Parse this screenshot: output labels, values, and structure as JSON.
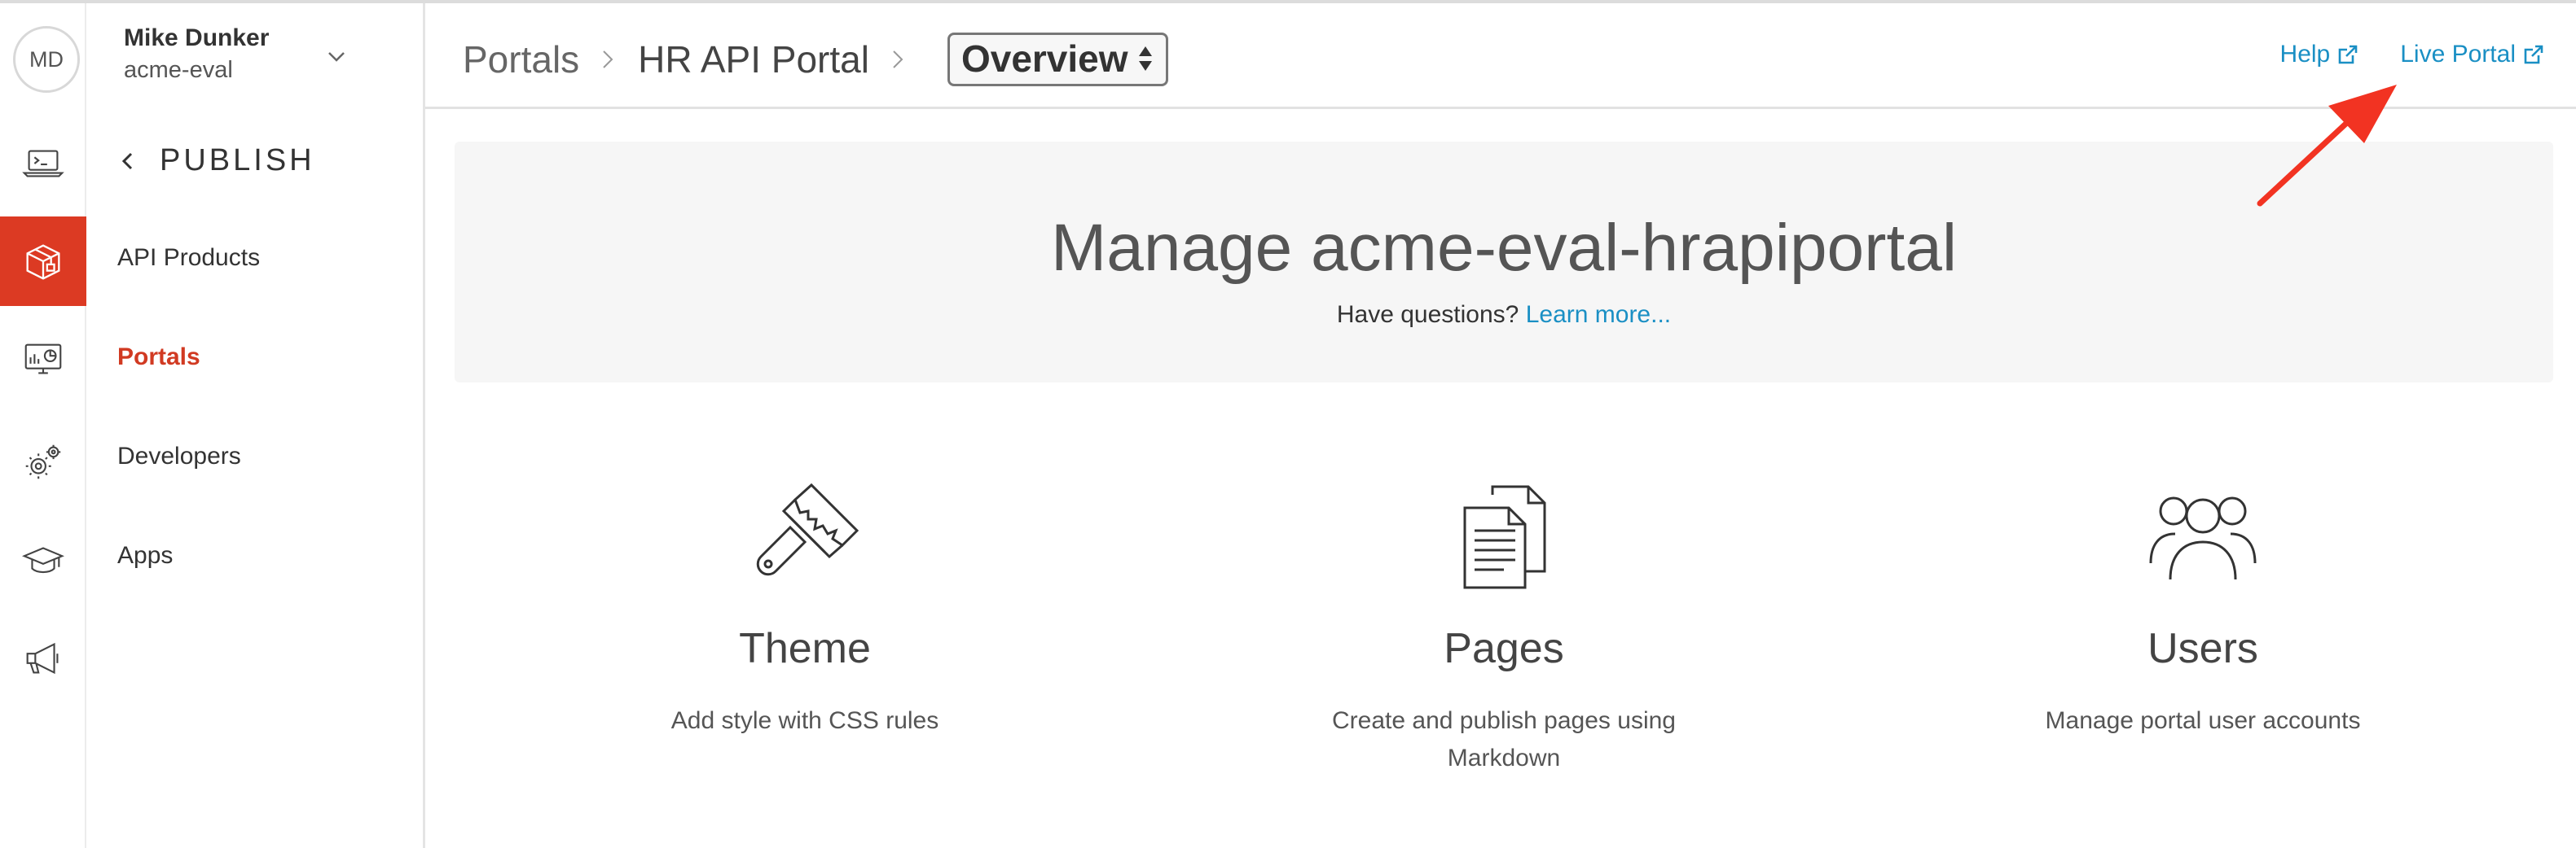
{
  "user": {
    "initials": "MD",
    "name": "Mike Dunker",
    "org": "acme-eval"
  },
  "rail": [
    {
      "icon": "terminal-laptop-icon",
      "active": false
    },
    {
      "icon": "package-icon",
      "active": true
    },
    {
      "icon": "monitor-chart-icon",
      "active": false
    },
    {
      "icon": "gears-icon",
      "active": false
    },
    {
      "icon": "graduation-cap-icon",
      "active": false
    },
    {
      "icon": "megaphone-icon",
      "active": false
    }
  ],
  "subnav": {
    "section": "PUBLISH",
    "items": [
      {
        "label": "API Products",
        "active": false
      },
      {
        "label": "Portals",
        "active": true
      },
      {
        "label": "Developers",
        "active": false
      },
      {
        "label": "Apps",
        "active": false
      }
    ]
  },
  "header": {
    "breadcrumbs": [
      "Portals",
      "HR API Portal"
    ],
    "select_value": "Overview",
    "links": {
      "help": "Help",
      "live_portal": "Live Portal"
    }
  },
  "banner": {
    "title": "Manage acme-eval-hrapiportal",
    "question": "Have questions?",
    "link": "Learn more..."
  },
  "cards": [
    {
      "icon": "paintbrush-icon",
      "title": "Theme",
      "desc": "Add style with CSS rules"
    },
    {
      "icon": "documents-icon",
      "title": "Pages",
      "desc": "Create and publish pages using Markdown"
    },
    {
      "icon": "users-icon",
      "title": "Users",
      "desc": "Manage portal user accounts"
    }
  ],
  "colors": {
    "accent": "#dc3a23",
    "link": "#1a8fc4",
    "banner_bg": "#f6f6f6",
    "annotation_arrow": "#f23322"
  }
}
